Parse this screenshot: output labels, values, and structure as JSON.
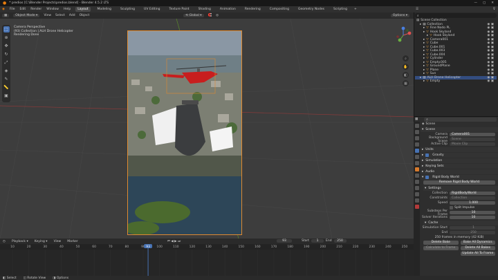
{
  "window": {
    "title": "* predios [C:\\Blender Projects\\predios.blend] - Blender 4.5.2 LTS"
  },
  "menu": {
    "items": [
      "File",
      "Edit",
      "Render",
      "Window",
      "Help"
    ],
    "workspaces": [
      "Layout",
      "Modeling",
      "Sculpting",
      "UV Editing",
      "Texture Paint",
      "Shading",
      "Animation",
      "Rendering",
      "Compositing",
      "Geometry Nodes",
      "Scripting"
    ],
    "active_workspace": "Layout",
    "scene": "Scene",
    "view_layer": "ViewLayer"
  },
  "viewport_header": {
    "mode": "Object Mode",
    "view": "View",
    "select": "Select",
    "add": "Add",
    "object": "Object",
    "orientation": "Global",
    "options": "Options"
  },
  "viewport_info": {
    "line1": "Camera Perspective",
    "line2": "(93) Collection | ALH Drone Helicopter",
    "line3": "Rendering Done"
  },
  "outliner": {
    "search_placeholder": "",
    "title": "Scene Collection",
    "rows": [
      {
        "label": "Collection",
        "indent": 1
      },
      {
        "label": "Fine Nodo PL",
        "indent": 2
      },
      {
        "label": "Hook Skyland",
        "indent": 2
      },
      {
        "label": "Hook Skyland",
        "indent": 3
      },
      {
        "label": "Camera001",
        "indent": 2
      },
      {
        "label": "Cube",
        "indent": 2
      },
      {
        "label": "Cube.001",
        "indent": 2
      },
      {
        "label": "Cube.003",
        "indent": 2
      },
      {
        "label": "Cube.004",
        "indent": 2
      },
      {
        "label": "Cylinder",
        "indent": 2
      },
      {
        "label": "Empty.005",
        "indent": 2
      },
      {
        "label": "GroundPlane",
        "indent": 2
      },
      {
        "label": "Plane",
        "indent": 2
      },
      {
        "label": "Sun",
        "indent": 2
      },
      {
        "label": "ALH Drone Helicopter",
        "indent": 1,
        "selected": true
      },
      {
        "label": "Empty",
        "indent": 2
      }
    ]
  },
  "properties": {
    "scene_name": "Scene",
    "scene_section": "Scene",
    "camera_label": "Camera",
    "camera_value": "Camera001",
    "bg_scene_label": "Background Scene",
    "bg_scene_value": "Scene",
    "active_clip_label": "Active Clip",
    "active_clip_value": "Movie Clip",
    "units": "Units",
    "gravity": "Gravity",
    "simulation": "Simulation",
    "keying_sets": "Keying Sets",
    "audio": "Audio",
    "rigid_body_world": "Rigid Body World",
    "remove_rbw": "Remove Rigid Body World",
    "settings": "Settings",
    "collection_label": "Collection",
    "collection_value": "RigidBodyWorld",
    "constraints_label": "Constraints",
    "constraints_value": "Collection",
    "speed_label": "Speed",
    "speed_value": "1.000",
    "split_impulse": "Split Impulse",
    "substeps_label": "Substeps Per Frame",
    "substeps_value": "10",
    "solver_label": "Solver Iterations",
    "solver_value": "10",
    "cache": "Cache",
    "sim_start_label": "Simulation Start",
    "sim_start_value": "1",
    "end_label": "End",
    "end_value": "250",
    "cache_info": "250 frames in memory (42 KiB)",
    "delete_bake": "Delete Bake",
    "bake_all": "Bake All Dynamics",
    "calc_to_frame": "Calculate to Frame",
    "delete_all_bakes": "Delete All Bakes",
    "update_all": "Update All To Frame"
  },
  "timeline": {
    "menu": [
      "Playback",
      "Keying",
      "View",
      "Marker"
    ],
    "current_frame": "93",
    "start_label": "Start",
    "start_value": "1",
    "end_label": "End",
    "end_value": "250",
    "ticks": [
      "10",
      "20",
      "30",
      "40",
      "50",
      "60",
      "70",
      "80",
      "90",
      "100",
      "110",
      "120",
      "130",
      "140",
      "150",
      "160",
      "170",
      "180",
      "190",
      "200",
      "210",
      "220",
      "230",
      "240",
      "250"
    ]
  },
  "status": {
    "select": "Select",
    "rotate": "Rotate View",
    "options": "Options"
  },
  "colors": {
    "accent": "#4772b3",
    "camera_frame": "#e08a30",
    "playhead": "#4772b3"
  }
}
